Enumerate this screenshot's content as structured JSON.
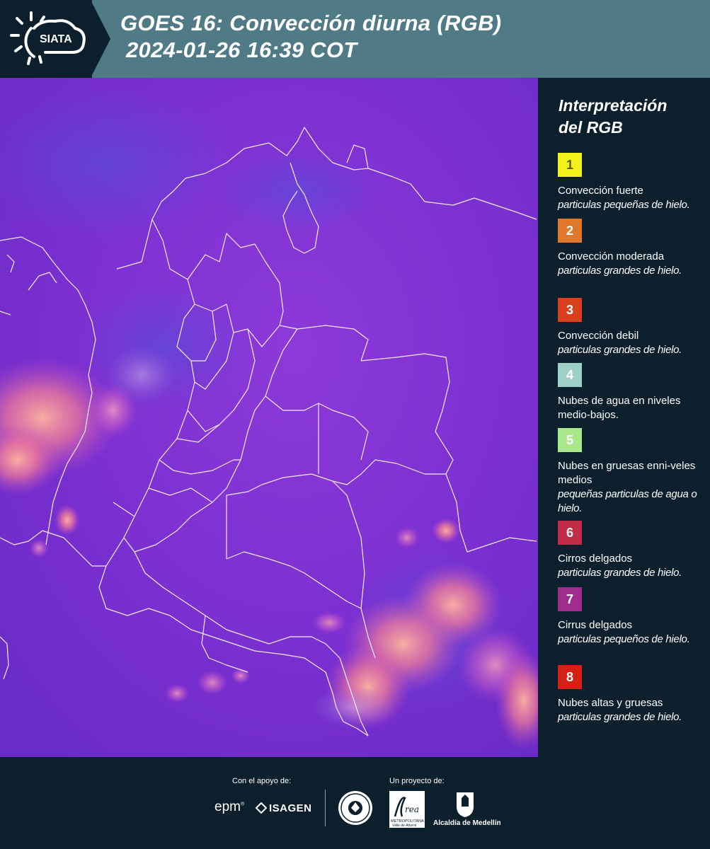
{
  "header": {
    "logo_text": "SIATA",
    "title_line1": "GOES 16: Convección diurna (RGB)",
    "title_line2": "2024-01-26 16:39 COT"
  },
  "legend": {
    "title_line1": "Interpretación",
    "title_line2": "del RGB",
    "entries": [
      {
        "number": "1",
        "color": "#f2f21a",
        "label": "Convección fuerte",
        "sub": "particulas pequeñas de hielo."
      },
      {
        "number": "2",
        "color": "#e0782c",
        "label": "Convección moderada",
        "sub": "particulas grandes de hielo."
      },
      {
        "number": "3",
        "color": "#d9411e",
        "label": "Convección debil",
        "sub": "particulas grandes de hielo."
      },
      {
        "number": "4",
        "color": "#9fd0c8",
        "label": "Nubes de agua en niveles medio-bajos.",
        "sub": ""
      },
      {
        "number": "5",
        "color": "#a9e68c",
        "label": "Nubes en gruesas enni-veles medios",
        "sub": "pequeñas particulas de agua o hielo."
      },
      {
        "number": "6",
        "color": "#c02c46",
        "label": "Cirros delgados",
        "sub": "particulas grandes de hielo."
      },
      {
        "number": "7",
        "color": "#a02d8e",
        "label": "Cirrus delgados",
        "sub": "particulas pequeños de hielo."
      },
      {
        "number": "8",
        "color": "#d62016",
        "label": "Nubes altas y gruesas",
        "sub": "particulas grandes de hielo."
      }
    ]
  },
  "footer": {
    "support_label": "Con el apoyo de:",
    "project_label": "Un proyecto de:",
    "logos": [
      "epm",
      "ISAGEN",
      "Área Metropolitana Valle de Aburrá",
      "Alcaldía de Medellín"
    ],
    "epm_text": "epm",
    "isagen_text": "ISAGEN",
    "amva_line1": "METROPOLITANA",
    "amva_line2": "Valle de Aburrá",
    "alcaldia_text": "Alcaldía de Medellín"
  }
}
